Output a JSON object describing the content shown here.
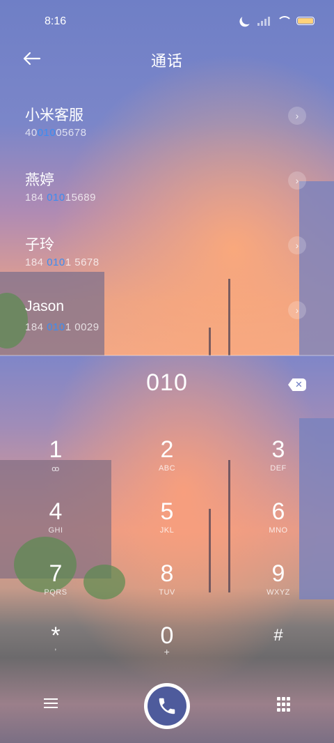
{
  "status_bar": {
    "time": "8:16"
  },
  "header": {
    "title": "通话"
  },
  "contacts": [
    {
      "name": "小米客服",
      "num_pre": "40",
      "num_hl": "010",
      "num_post": "05678"
    },
    {
      "name": "燕婷",
      "num_pre": "184 ",
      "num_hl": "010",
      "num_post": "15689"
    },
    {
      "name": "子玲",
      "num_pre": "184 ",
      "num_hl": "010",
      "num_post": "1 5678"
    },
    {
      "name": "Jason",
      "num_pre": "184 ",
      "num_hl": "010",
      "num_post": "1 0029"
    }
  ],
  "dialer": {
    "input": "010",
    "keys": [
      {
        "digit": "1",
        "letters": "ꝏ"
      },
      {
        "digit": "2",
        "letters": "ABC"
      },
      {
        "digit": "3",
        "letters": "DEF"
      },
      {
        "digit": "4",
        "letters": "GHI"
      },
      {
        "digit": "5",
        "letters": "JKL"
      },
      {
        "digit": "6",
        "letters": "MNO"
      },
      {
        "digit": "7",
        "letters": "PQRS"
      },
      {
        "digit": "8",
        "letters": "TUV"
      },
      {
        "digit": "9",
        "letters": "WXYZ"
      },
      {
        "digit": "*",
        "letters": ","
      },
      {
        "digit": "0",
        "letters": "+"
      },
      {
        "digit": "#",
        "letters": ""
      }
    ]
  },
  "colors": {
    "highlight": "#3b8df2",
    "call_button": "#4e5b9c"
  },
  "icons": {
    "back": "arrow-left-icon",
    "delete": "backspace-icon",
    "menu": "menu-icon",
    "call": "phone-icon",
    "keypad": "keypad-icon"
  }
}
